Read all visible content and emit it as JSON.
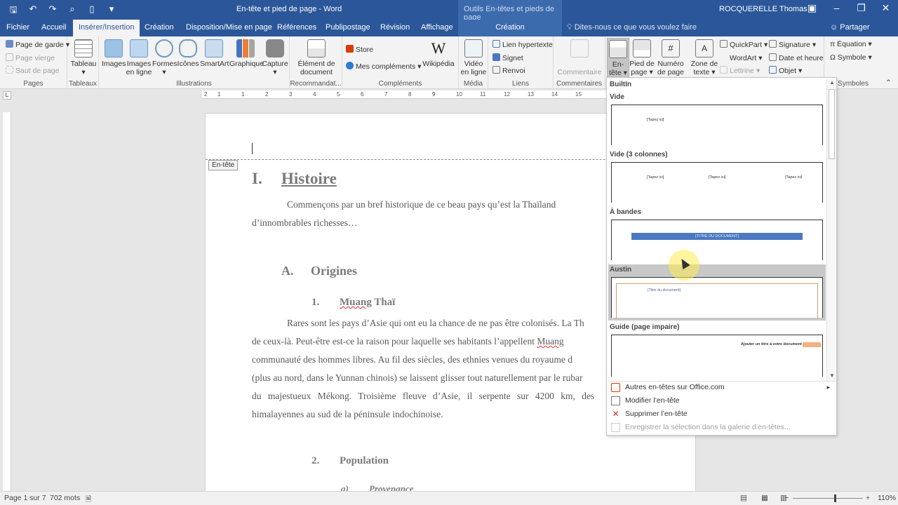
{
  "window": {
    "title": "En-tête et pied de page - Word",
    "context_title": "Outils En-têtes et pieds de page",
    "user": "ROCQUERELLE Thomas"
  },
  "tabs": [
    "Fichier",
    "Accueil",
    "Insérer/Insertion",
    "Création",
    "Disposition/Mise en page",
    "Références",
    "Publipostage",
    "Révision",
    "Affichage"
  ],
  "context_tab": "Création",
  "tell_me": "Dites-nous ce que vous voulez faire",
  "share": "Partager",
  "ribbon": {
    "pages": {
      "label": "Pages",
      "cover": "Page de garde",
      "blank": "Page vierge",
      "break": "Saut de page"
    },
    "tables": {
      "label": "Tableaux",
      "table": "Tableau"
    },
    "illustrations": {
      "label": "Illustrations",
      "images": "Images",
      "online_images": "Images en ligne",
      "shapes": "Formes",
      "icons": "Icônes",
      "smartart": "SmartArt",
      "chart": "Graphique",
      "capture": "Capture"
    },
    "recommend": {
      "label": "Recommandat...",
      "item": "Élément de document"
    },
    "addins": {
      "label": "Compléments",
      "store": "Store",
      "my_addins": "Mes compléments",
      "wikipedia": "Wikipédia"
    },
    "media": {
      "label": "Média",
      "video": "Vidéo en ligne"
    },
    "links": {
      "label": "Liens",
      "hyperlink": "Lien hypertexte",
      "bookmark": "Signet",
      "crossref": "Renvoi"
    },
    "comments": {
      "label": "Commentaires",
      "comment": "Commentaire"
    },
    "header_footer": {
      "header": "En-tête",
      "footer": "Pied de page",
      "page_number": "Numéro de page"
    },
    "text": {
      "textbox": "Zone de texte",
      "quickpart": "QuickPart",
      "wordart": "WordArt",
      "dropcap": "Lettrine",
      "signature": "Signature",
      "datetime": "Date et heure",
      "object": "Objet"
    },
    "symbols": {
      "label": "Symboles",
      "equation": "Équation",
      "symbol": "Symbole"
    }
  },
  "ruler_ticks": [
    "2",
    "1",
    "1",
    "2",
    "3",
    "4",
    "5",
    "6",
    "7",
    "8",
    "9",
    "10",
    "11",
    "12",
    "13",
    "14",
    "15"
  ],
  "document": {
    "header_tag": "En-tête",
    "h1_num": "I.",
    "h1_text": "Histoire",
    "intro_lines": [
      "Commençons par un bref historique de ce beau pays qu’est la Thaïland",
      "d’innombrables richesses…"
    ],
    "h2_num": "A.",
    "h2_text": "Origines",
    "h3a_num": "1.",
    "h3a_text_a": "Muang",
    "h3a_text_b": " Thaï",
    "body_lines": [
      "Rares sont les pays d’Asie qui ont eu la chance de ne pas être colonisés. La Th",
      "de ceux-là. Peut-être est-ce la raison pour laquelle ses habitants l’appellent ",
      "communauté des hommes libres. Au fil des siècles, des ethnies venues du royaume d",
      "(plus au nord, dans le Yunnan chinois) se laissent glisser tout naturellement par le rubar",
      "du majestueux Mékong. Troisième fleuve d’Asie, il serpente sur 4200 km, des",
      "himalayennes au sud de la péninsule indochinoise."
    ],
    "body_squig": "Muang",
    "h3b_num": "2.",
    "h3b_text": "Population",
    "h4_num": "a)",
    "h4_text": "Provenance"
  },
  "gallery": {
    "section": "BuiltIn",
    "items": [
      {
        "name": "Vide",
        "ph": "[Tapez ici]"
      },
      {
        "name": "Vide (3 colonnes)",
        "ph": "[Tapez ici]"
      },
      {
        "name": "À bandes",
        "ph": "[TITRE DU DOCUMENT]"
      },
      {
        "name": "Austin",
        "ph": "[Titre du document]"
      },
      {
        "name": "Guide (page impaire)",
        "ph": "Ajouter un titre à votre document"
      }
    ],
    "menu": {
      "more": "Autres en-têtes sur Office.com",
      "edit": "Modifier l’en-tête",
      "remove": "Supprimer l’en-tête",
      "save": "Enregistrer la sélection dans la galerie d’en-têtes..."
    }
  },
  "status": {
    "page": "Page 1 sur 7",
    "words": "702 mots",
    "zoom": "110%"
  },
  "colors": {
    "brand": "#2b579a",
    "band": "#4a78c2",
    "guide_accent": "#f4b183"
  }
}
